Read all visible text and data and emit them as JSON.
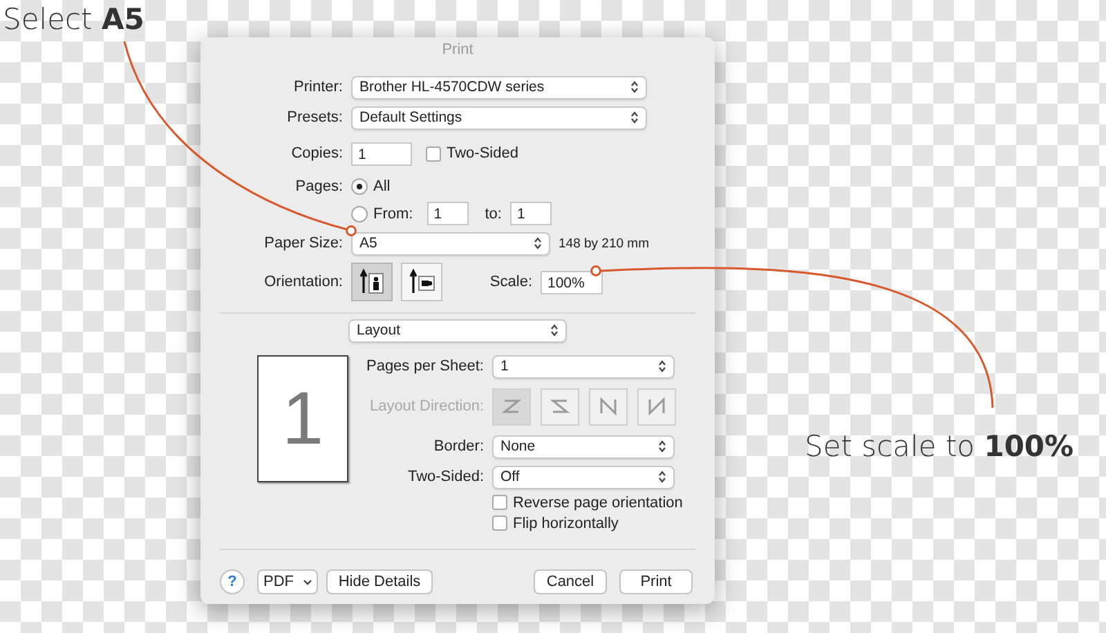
{
  "window": {
    "title": "Print"
  },
  "printer": {
    "label": "Printer:",
    "value": "Brother HL-4570CDW series"
  },
  "presets": {
    "label": "Presets:",
    "value": "Default Settings"
  },
  "copies": {
    "label": "Copies:",
    "value": "1",
    "two_sided": {
      "label": "Two-Sided",
      "checked": false
    }
  },
  "pages": {
    "label": "Pages:",
    "options": [
      {
        "kind": "all",
        "label": "All",
        "selected": true
      },
      {
        "kind": "range",
        "label": "From:",
        "selected": false,
        "from": "1",
        "to_label": "to:",
        "to": "1"
      }
    ]
  },
  "paper_size": {
    "label": "Paper Size:",
    "value": "A5",
    "dimensions": "148 by 210 mm"
  },
  "orientation": {
    "label": "Orientation:",
    "options": [
      {
        "kind": "portrait",
        "selected": true
      },
      {
        "kind": "landscape",
        "selected": false
      }
    ]
  },
  "scale": {
    "label": "Scale:",
    "value": "100%"
  },
  "section": {
    "value": "Layout"
  },
  "preview": {
    "page_number": "1"
  },
  "layout": {
    "pages_per_sheet": {
      "label": "Pages per Sheet:",
      "value": "1"
    },
    "layout_direction": {
      "label": "Layout Direction:",
      "disabled": true,
      "options": [
        {
          "kind": "z",
          "selected": true
        },
        {
          "kind": "s",
          "selected": false
        },
        {
          "kind": "n_reverse",
          "selected": false
        },
        {
          "kind": "n",
          "selected": false
        }
      ]
    },
    "border": {
      "label": "Border:",
      "value": "None"
    },
    "two_sided": {
      "label": "Two-Sided:",
      "value": "Off"
    },
    "checkboxes": [
      {
        "label": "Reverse page orientation",
        "checked": false
      },
      {
        "label": "Flip horizontally",
        "checked": false
      }
    ]
  },
  "footer": {
    "help": "?",
    "pdf": "PDF",
    "hide_details": "Hide Details",
    "cancel": "Cancel",
    "print": "Print"
  },
  "annotations": [
    {
      "kind": "paper",
      "text": "Select **A5**"
    },
    {
      "kind": "scale",
      "text": "Set scale to **100%**"
    }
  ]
}
